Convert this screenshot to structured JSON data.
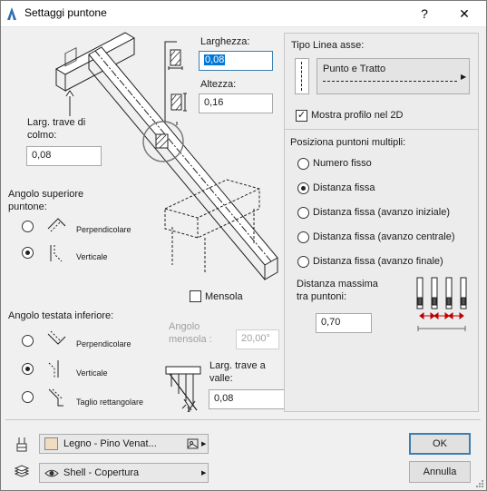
{
  "window": {
    "title": "Settaggi puntone",
    "help": "?",
    "close": "✕"
  },
  "left": {
    "larghezza_label": "Larghezza:",
    "larghezza_value": "0,08",
    "altezza_label": "Altezza:",
    "altezza_value": "0,16",
    "larg_trave_colmo_label": "Larg. trave di colmo:",
    "larg_trave_colmo_value": "0,08",
    "angolo_superiore_label": "Angolo superiore puntone:",
    "sup_perpendicolare": "Perpendicolare",
    "sup_verticale": "Verticale",
    "mensola_label": "Mensola",
    "angolo_testata_label": "Angolo testata inferiore:",
    "inf_perpendicolare": "Perpendicolare",
    "inf_verticale": "Verticale",
    "inf_taglio": "Taglio rettangolare",
    "angolo_mensola_label": "Angolo mensola :",
    "angolo_mensola_value": "20,00°",
    "larg_trave_valle_label": "Larg. trave a valle:",
    "larg_trave_valle_value": "0,08"
  },
  "right": {
    "tipo_linea_label": "Tipo Linea asse:",
    "tipo_linea_value": "Punto e Tratto",
    "mostra_profilo_label": "Mostra profilo nel 2D",
    "posiziona_label": "Posiziona puntoni multipli:",
    "opt_numero_fisso": "Numero fisso",
    "opt_distanza_fissa": "Distanza fissa",
    "opt_distanza_iniziale": "Distanza fissa (avanzo iniziale)",
    "opt_distanza_centrale": "Distanza fissa (avanzo centrale)",
    "opt_distanza_finale": "Distanza fissa (avanzo finale)",
    "distanza_massima_label": "Distanza massima tra puntoni:",
    "distanza_massima_value": "0,70"
  },
  "bottom": {
    "material_value": "Legno - Pino Venat...",
    "layer_value": "Shell - Copertura",
    "ok_label": "OK",
    "cancel_label": "Annulla"
  },
  "colors": {
    "material_swatch": "#f2dcc0",
    "default_border": "#3c7fb1",
    "selection": "#0078d7"
  }
}
